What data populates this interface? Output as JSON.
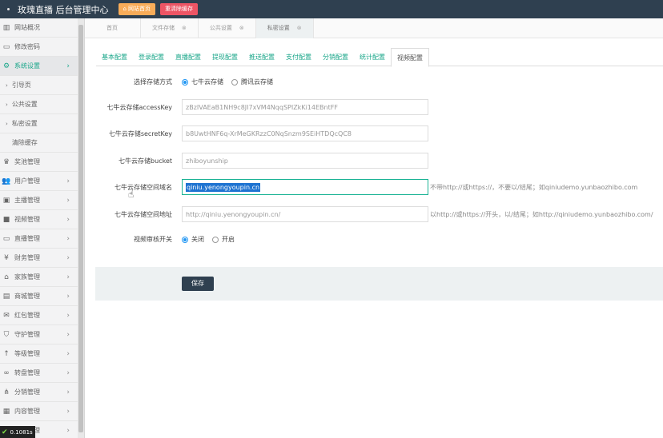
{
  "header": {
    "title": "玫瑰直播 后台管理中心",
    "btn_home": "网站首页",
    "btn_cache": "重清除缓存"
  },
  "sidebar": {
    "items": [
      {
        "label": "网站概况",
        "icon": "chart-icon"
      },
      {
        "label": "修改密码",
        "icon": "monitor-icon"
      },
      {
        "label": "系统设置",
        "icon": "gear-icon",
        "active": true
      },
      {
        "label": "引导页",
        "sub": true
      },
      {
        "label": "公共设置",
        "sub": true
      },
      {
        "label": "私密设置",
        "sub": true
      },
      {
        "label": "清除缓存",
        "sub": true
      },
      {
        "label": "奖池管理",
        "icon": "trophy-icon"
      },
      {
        "label": "用户管理",
        "icon": "users-icon"
      },
      {
        "label": "主播管理",
        "icon": "id-card-icon"
      },
      {
        "label": "视频管理",
        "icon": "video-icon"
      },
      {
        "label": "直播管理",
        "icon": "desktop-icon"
      },
      {
        "label": "财务管理",
        "icon": "yen-icon"
      },
      {
        "label": "家族管理",
        "icon": "bank-icon"
      },
      {
        "label": "商城管理",
        "icon": "shop-icon"
      },
      {
        "label": "红包管理",
        "icon": "envelope-icon"
      },
      {
        "label": "守护管理",
        "icon": "shield-icon"
      },
      {
        "label": "等级管理",
        "icon": "level-icon"
      },
      {
        "label": "转盘管理",
        "icon": "gamepad-icon"
      },
      {
        "label": "分销管理",
        "icon": "sitemap-icon"
      },
      {
        "label": "内容管理",
        "icon": "grid-icon"
      },
      {
        "label": "消息管理",
        "icon": "bell-icon"
      }
    ]
  },
  "page_tabs": [
    {
      "label": "首页"
    },
    {
      "label": "文件存储"
    },
    {
      "label": "公共设置"
    },
    {
      "label": "私密设置",
      "active": true
    }
  ],
  "content_tabs": [
    "基本配置",
    "登录配置",
    "直播配置",
    "提现配置",
    "推送配置",
    "支付配置",
    "分销配置",
    "统计配置",
    "视频配置"
  ],
  "form": {
    "storage_label": "选择存储方式",
    "storage_opt1": "七牛云存储",
    "storage_opt2": "腾讯云存储",
    "ak_label": "七牛云存储accessKey",
    "ak_value": "zBzIVAEaB1NH9c8JI7xVM4NqqSPIZkKi14EBntFF",
    "sk_label": "七牛云存储secretKey",
    "sk_value": "b8UwtHNF6q-XrMeGKRzzC0NqSnzm9SEiHTDQcQC8",
    "bucket_label": "七牛云存储bucket",
    "bucket_value": "zhiboyunship",
    "domain_label": "七牛云存储空间域名",
    "domain_value": "qiniu.yenongyoupin.cn",
    "domain_hint": "不带http://或https://，不要以/结尾；如qiniudemo.yunbaozhibo.com",
    "url_label": "七牛云存储空间地址",
    "url_value": "http://qiniu.yenongyoupin.cn/",
    "url_hint": "以http://或https://开头，以/结尾；如http://qiniudemo.yunbaozhibo.com/",
    "audit_label": "视频审核开关",
    "audit_off": "关闭",
    "audit_on": "开启",
    "save": "保存"
  },
  "status": {
    "value": "0.1081s"
  }
}
